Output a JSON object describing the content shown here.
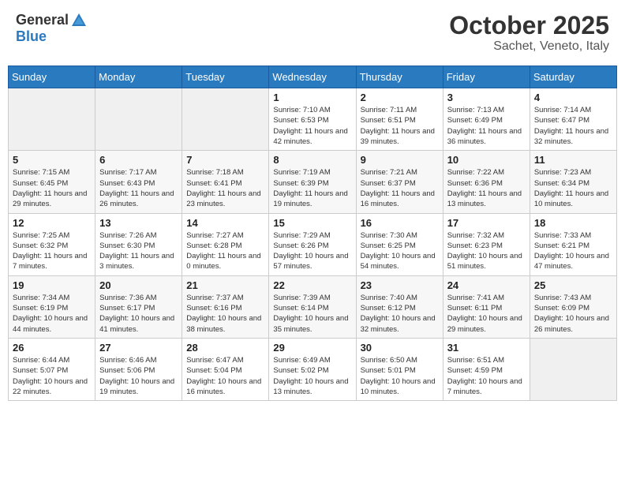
{
  "header": {
    "logo_general": "General",
    "logo_blue": "Blue",
    "month": "October 2025",
    "location": "Sachet, Veneto, Italy"
  },
  "days_of_week": [
    "Sunday",
    "Monday",
    "Tuesday",
    "Wednesday",
    "Thursday",
    "Friday",
    "Saturday"
  ],
  "weeks": [
    [
      {
        "day": "",
        "info": ""
      },
      {
        "day": "",
        "info": ""
      },
      {
        "day": "",
        "info": ""
      },
      {
        "day": "1",
        "info": "Sunrise: 7:10 AM\nSunset: 6:53 PM\nDaylight: 11 hours and 42 minutes."
      },
      {
        "day": "2",
        "info": "Sunrise: 7:11 AM\nSunset: 6:51 PM\nDaylight: 11 hours and 39 minutes."
      },
      {
        "day": "3",
        "info": "Sunrise: 7:13 AM\nSunset: 6:49 PM\nDaylight: 11 hours and 36 minutes."
      },
      {
        "day": "4",
        "info": "Sunrise: 7:14 AM\nSunset: 6:47 PM\nDaylight: 11 hours and 32 minutes."
      }
    ],
    [
      {
        "day": "5",
        "info": "Sunrise: 7:15 AM\nSunset: 6:45 PM\nDaylight: 11 hours and 29 minutes."
      },
      {
        "day": "6",
        "info": "Sunrise: 7:17 AM\nSunset: 6:43 PM\nDaylight: 11 hours and 26 minutes."
      },
      {
        "day": "7",
        "info": "Sunrise: 7:18 AM\nSunset: 6:41 PM\nDaylight: 11 hours and 23 minutes."
      },
      {
        "day": "8",
        "info": "Sunrise: 7:19 AM\nSunset: 6:39 PM\nDaylight: 11 hours and 19 minutes."
      },
      {
        "day": "9",
        "info": "Sunrise: 7:21 AM\nSunset: 6:37 PM\nDaylight: 11 hours and 16 minutes."
      },
      {
        "day": "10",
        "info": "Sunrise: 7:22 AM\nSunset: 6:36 PM\nDaylight: 11 hours and 13 minutes."
      },
      {
        "day": "11",
        "info": "Sunrise: 7:23 AM\nSunset: 6:34 PM\nDaylight: 11 hours and 10 minutes."
      }
    ],
    [
      {
        "day": "12",
        "info": "Sunrise: 7:25 AM\nSunset: 6:32 PM\nDaylight: 11 hours and 7 minutes."
      },
      {
        "day": "13",
        "info": "Sunrise: 7:26 AM\nSunset: 6:30 PM\nDaylight: 11 hours and 3 minutes."
      },
      {
        "day": "14",
        "info": "Sunrise: 7:27 AM\nSunset: 6:28 PM\nDaylight: 11 hours and 0 minutes."
      },
      {
        "day": "15",
        "info": "Sunrise: 7:29 AM\nSunset: 6:26 PM\nDaylight: 10 hours and 57 minutes."
      },
      {
        "day": "16",
        "info": "Sunrise: 7:30 AM\nSunset: 6:25 PM\nDaylight: 10 hours and 54 minutes."
      },
      {
        "day": "17",
        "info": "Sunrise: 7:32 AM\nSunset: 6:23 PM\nDaylight: 10 hours and 51 minutes."
      },
      {
        "day": "18",
        "info": "Sunrise: 7:33 AM\nSunset: 6:21 PM\nDaylight: 10 hours and 47 minutes."
      }
    ],
    [
      {
        "day": "19",
        "info": "Sunrise: 7:34 AM\nSunset: 6:19 PM\nDaylight: 10 hours and 44 minutes."
      },
      {
        "day": "20",
        "info": "Sunrise: 7:36 AM\nSunset: 6:17 PM\nDaylight: 10 hours and 41 minutes."
      },
      {
        "day": "21",
        "info": "Sunrise: 7:37 AM\nSunset: 6:16 PM\nDaylight: 10 hours and 38 minutes."
      },
      {
        "day": "22",
        "info": "Sunrise: 7:39 AM\nSunset: 6:14 PM\nDaylight: 10 hours and 35 minutes."
      },
      {
        "day": "23",
        "info": "Sunrise: 7:40 AM\nSunset: 6:12 PM\nDaylight: 10 hours and 32 minutes."
      },
      {
        "day": "24",
        "info": "Sunrise: 7:41 AM\nSunset: 6:11 PM\nDaylight: 10 hours and 29 minutes."
      },
      {
        "day": "25",
        "info": "Sunrise: 7:43 AM\nSunset: 6:09 PM\nDaylight: 10 hours and 26 minutes."
      }
    ],
    [
      {
        "day": "26",
        "info": "Sunrise: 6:44 AM\nSunset: 5:07 PM\nDaylight: 10 hours and 22 minutes."
      },
      {
        "day": "27",
        "info": "Sunrise: 6:46 AM\nSunset: 5:06 PM\nDaylight: 10 hours and 19 minutes."
      },
      {
        "day": "28",
        "info": "Sunrise: 6:47 AM\nSunset: 5:04 PM\nDaylight: 10 hours and 16 minutes."
      },
      {
        "day": "29",
        "info": "Sunrise: 6:49 AM\nSunset: 5:02 PM\nDaylight: 10 hours and 13 minutes."
      },
      {
        "day": "30",
        "info": "Sunrise: 6:50 AM\nSunset: 5:01 PM\nDaylight: 10 hours and 10 minutes."
      },
      {
        "day": "31",
        "info": "Sunrise: 6:51 AM\nSunset: 4:59 PM\nDaylight: 10 hours and 7 minutes."
      },
      {
        "day": "",
        "info": ""
      }
    ]
  ]
}
